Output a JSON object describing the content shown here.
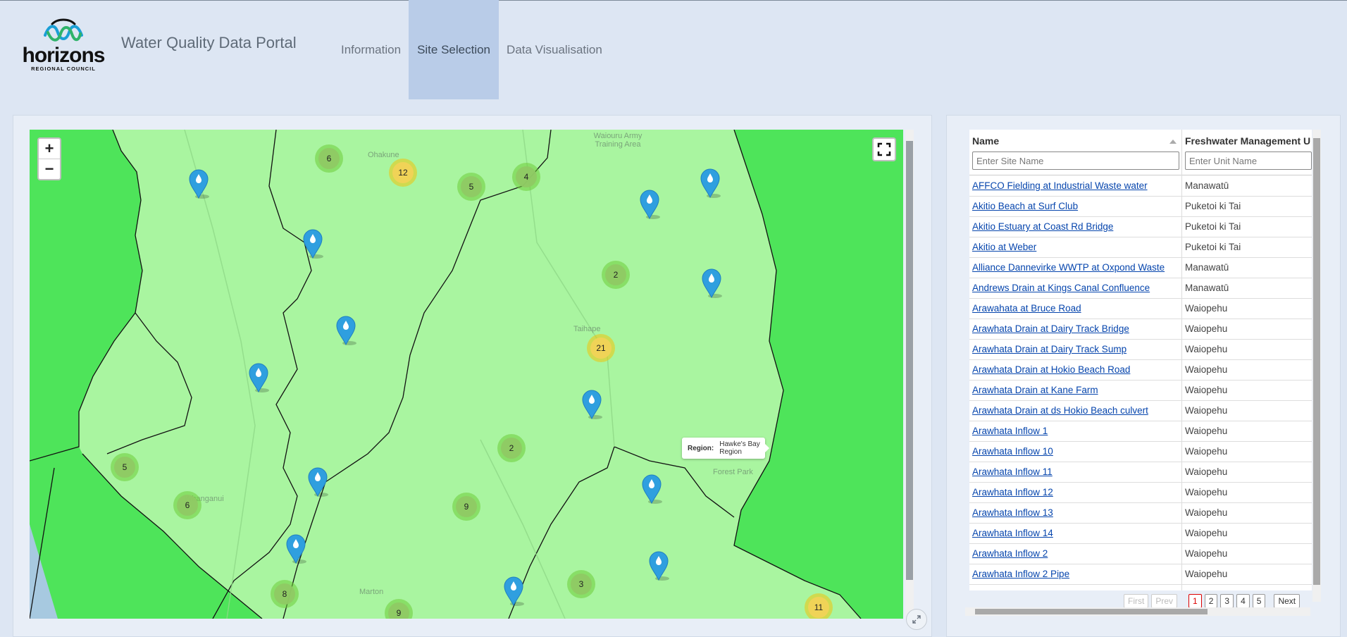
{
  "header": {
    "logo_text": "horizons",
    "logo_subtext": "REGIONAL COUNCIL",
    "title": "Water Quality Data Portal",
    "nav": [
      {
        "label": "Information",
        "active": false
      },
      {
        "label": "Site Selection",
        "active": true
      },
      {
        "label": "Data Visualisation",
        "active": false
      }
    ]
  },
  "map": {
    "zoom_in": "+",
    "zoom_out": "−",
    "tooltip": {
      "key": "Region:",
      "value": "Hawke's Bay Region"
    },
    "place_labels": [
      "Ohakune",
      "Taihape",
      "Whanganui",
      "Marton",
      "Waiouru Army Training Area",
      "Forest Park"
    ],
    "clusters": [
      {
        "count": "6",
        "tier": "small"
      },
      {
        "count": "12",
        "tier": "medium"
      },
      {
        "count": "5",
        "tier": "small"
      },
      {
        "count": "4",
        "tier": "small"
      },
      {
        "count": "2",
        "tier": "small"
      },
      {
        "count": "21",
        "tier": "medium"
      },
      {
        "count": "2",
        "tier": "small"
      },
      {
        "count": "5",
        "tier": "small"
      },
      {
        "count": "6",
        "tier": "small"
      },
      {
        "count": "9",
        "tier": "small"
      },
      {
        "count": "3",
        "tier": "small"
      },
      {
        "count": "8",
        "tier": "small"
      },
      {
        "count": "9",
        "tier": "small"
      },
      {
        "count": "11",
        "tier": "medium"
      }
    ],
    "colors": {
      "region_fill": "#a9f5a0",
      "outside_fill": "#4ee45a",
      "pin": "#2f9fdf",
      "sea": "#a7c9e0"
    }
  },
  "table": {
    "columns": [
      "Name",
      "Freshwater Management U"
    ],
    "filters": {
      "name_placeholder": "Enter Site Name",
      "unit_placeholder": "Enter Unit Name"
    },
    "rows": [
      {
        "name": "AFFCO Fielding at Industrial Waste water",
        "unit": "Manawatū"
      },
      {
        "name": "Akitio Beach at Surf Club",
        "unit": "Puketoi ki Tai"
      },
      {
        "name": "Akitio Estuary at Coast Rd Bridge",
        "unit": "Puketoi ki Tai"
      },
      {
        "name": "Akitio at Weber",
        "unit": "Puketoi ki Tai"
      },
      {
        "name": "Alliance Dannevirke WWTP at Oxpond Waste",
        "unit": "Manawatū"
      },
      {
        "name": "Andrews Drain at Kings Canal Confluence",
        "unit": "Manawatū"
      },
      {
        "name": "Arawahata at Bruce Road",
        "unit": "Waiopehu"
      },
      {
        "name": "Arawhata Drain at Dairy Track Bridge",
        "unit": "Waiopehu"
      },
      {
        "name": "Arawhata Drain at Dairy Track Sump",
        "unit": "Waiopehu"
      },
      {
        "name": "Arawhata Drain at Hokio Beach Road",
        "unit": "Waiopehu"
      },
      {
        "name": "Arawhata Drain at Kane Farm",
        "unit": "Waiopehu"
      },
      {
        "name": "Arawhata Drain at ds Hokio Beach culvert",
        "unit": "Waiopehu"
      },
      {
        "name": "Arawhata Inflow 1",
        "unit": "Waiopehu"
      },
      {
        "name": "Arawhata Inflow 10",
        "unit": "Waiopehu"
      },
      {
        "name": "Arawhata Inflow 11",
        "unit": "Waiopehu"
      },
      {
        "name": "Arawhata Inflow 12",
        "unit": "Waiopehu"
      },
      {
        "name": "Arawhata Inflow 13",
        "unit": "Waiopehu"
      },
      {
        "name": "Arawhata Inflow 14",
        "unit": "Waiopehu"
      },
      {
        "name": "Arawhata Inflow 2",
        "unit": "Waiopehu"
      },
      {
        "name": "Arawhata Inflow 2 Pipe",
        "unit": "Waiopehu"
      }
    ],
    "pager": {
      "first": "First",
      "prev": "Prev",
      "pages": [
        "1",
        "2",
        "3",
        "4",
        "5"
      ],
      "current": "1",
      "next": "Next"
    }
  }
}
